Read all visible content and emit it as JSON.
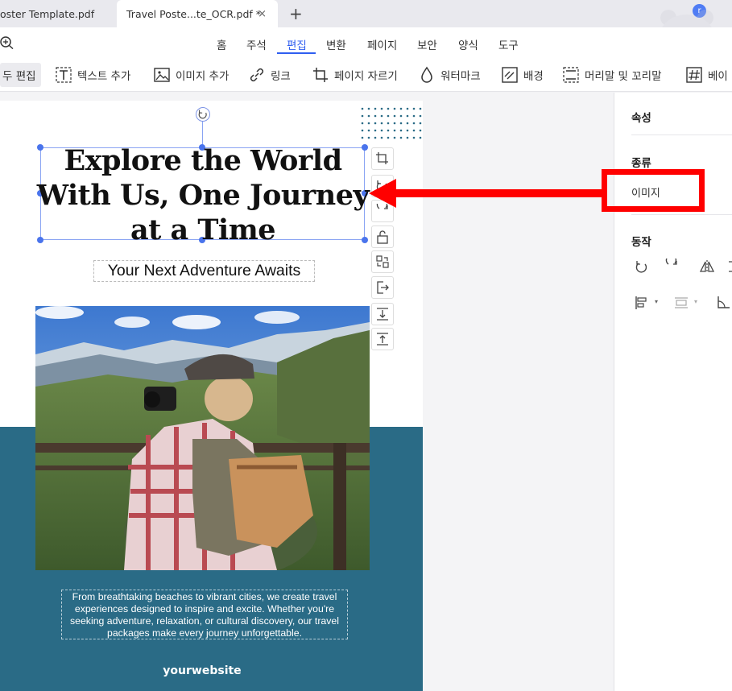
{
  "tabs": [
    {
      "label": "oster Template.pdf"
    },
    {
      "label": "Travel Poste...te_OCR.pdf *",
      "close": "×"
    }
  ],
  "new_tab": "+",
  "user_initial": "r",
  "menu": [
    {
      "label": "홈"
    },
    {
      "label": "주석"
    },
    {
      "label": "편집",
      "active": true
    },
    {
      "label": "변환"
    },
    {
      "label": "페이지"
    },
    {
      "label": "보안"
    },
    {
      "label": "양식"
    },
    {
      "label": "도구"
    }
  ],
  "toolbar": [
    {
      "label": "두 편집",
      "icon": "all-edit-icon"
    },
    {
      "label": "텍스트 추가",
      "icon": "text-add-icon"
    },
    {
      "label": "이미지 추가",
      "icon": "image-add-icon"
    },
    {
      "label": "링크",
      "icon": "link-icon"
    },
    {
      "label": "페이지 자르기",
      "icon": "crop-page-icon"
    },
    {
      "label": "워터마크",
      "icon": "watermark-icon"
    },
    {
      "label": "배경",
      "icon": "background-icon"
    },
    {
      "label": "머리말 및 꼬리말",
      "icon": "header-footer-icon"
    },
    {
      "label": "베이",
      "icon": "bates-icon"
    }
  ],
  "document": {
    "title": "Explore the World With Us, One Journey at a Time",
    "subtitle": "Your Next Adventure Awaits",
    "body": "From breathtaking beaches to vibrant cities, we create travel experiences designed to inspire and excite. Whether you're seeking adventure, relaxation, or cultural discovery, our travel packages make every journey unforgettable.",
    "website": "yourwebsite"
  },
  "panel": {
    "properties_label": "속성",
    "type_label": "종류",
    "type_value": "이미지",
    "actions_label": "동작"
  },
  "colors": {
    "accent": "#2f5ef0",
    "teal": "#2a6b86",
    "annotation": "#ff0000",
    "selection": "#4a74ec"
  }
}
